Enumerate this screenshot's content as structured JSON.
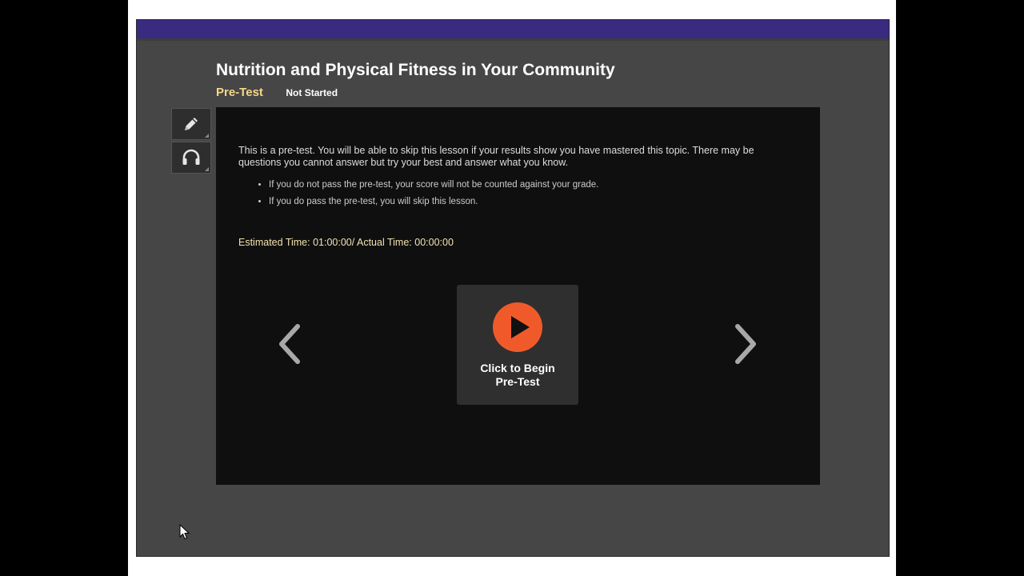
{
  "lesson": {
    "title": "Nutrition and Physical Fitness in Your Community",
    "activity": "Pre-Test",
    "status": "Not Started"
  },
  "tools": [
    {
      "name": "pencil-icon"
    },
    {
      "name": "headphones-icon"
    }
  ],
  "content": {
    "intro": "This is a pre-test. You will be able to skip this lesson if your results show you have mastered this topic. There may be questions you cannot answer but try your best and answer what you know.",
    "bullets": [
      "If you do not pass the pre-test, your score will not be counted against your grade.",
      "If you do pass the pre-test, you will skip this lesson."
    ],
    "time": "Estimated Time: 01:00:00/ Actual Time: 00:00:00",
    "begin_label": "Click to Begin\nPre-Test"
  },
  "colors": {
    "top_bar": "#3a2a80",
    "play_button": "#f05a2a",
    "activity_title": "#f5d78a"
  }
}
